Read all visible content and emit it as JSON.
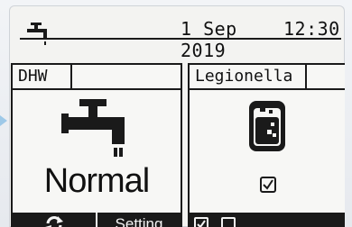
{
  "header": {
    "date": "1 Sep 2019",
    "time": "12:30",
    "icon": "tap-icon"
  },
  "dhw": {
    "title": "DHW",
    "icon": "tap-icon",
    "mode": "Normal",
    "buttons": {
      "refresh_icon": "refresh-icon",
      "setting_label": "Setting"
    }
  },
  "legionella": {
    "title": "Legionella",
    "icon": "tank-icon",
    "enabled": true,
    "buttons": {
      "check_on_icon": "checkbox-checked-icon",
      "check_off_icon": "checkbox-empty-icon"
    }
  },
  "colors": {
    "ink": "#1a1a1a",
    "screen": "#f3f3f1",
    "accent": "#9ec9e8"
  }
}
